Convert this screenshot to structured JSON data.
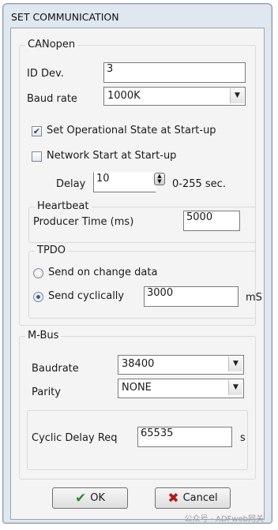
{
  "window": {
    "title": "SET COMMUNICATION"
  },
  "canopen": {
    "legend": "CANopen",
    "id_label": "ID Dev.",
    "id_value": "3",
    "baud_label": "Baud rate",
    "baud_value": "1000K",
    "opstate_label": "Set Operational State at Start-up",
    "opstate_checked": true,
    "netstart_label": "Network Start at Start-up",
    "netstart_checked": false,
    "delay_label": "Delay",
    "delay_value": "10",
    "delay_range": "0-255 sec."
  },
  "heartbeat": {
    "legend": "Heartbeat",
    "producer_label": "Producer Time (ms)",
    "producer_value": "5000"
  },
  "tpdo": {
    "legend": "TPDO",
    "option_change": "Send on change data",
    "option_cyclic": "Send cyclically",
    "selected": "cyclic",
    "cyclic_value": "3000",
    "cyclic_unit": "mS"
  },
  "mbus": {
    "legend": "M-Bus",
    "baud_label": "Baudrate",
    "baud_value": "38400",
    "parity_label": "Parity",
    "parity_value": "NONE",
    "cyclic_label": "Cyclic Delay Req",
    "cyclic_value": "65535",
    "cyclic_unit": "s"
  },
  "buttons": {
    "ok": "OK",
    "cancel": "Cancel"
  },
  "icons": {
    "ok": "checkmark-icon",
    "cancel": "x-icon"
  },
  "colors": {
    "ok_icon": "#2d8a2d",
    "cancel_icon": "#b01a1a"
  },
  "watermark": "公众号 · ADFweb网关"
}
